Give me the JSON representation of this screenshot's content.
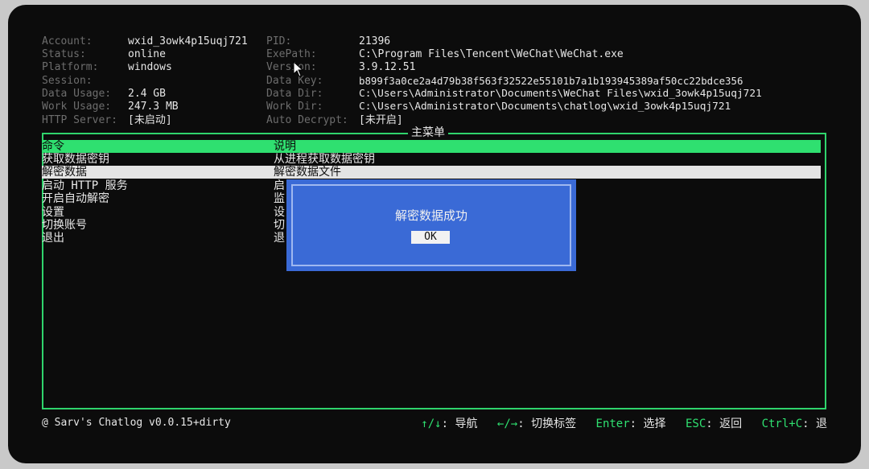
{
  "info_left": [
    {
      "label": "Account:",
      "value": "wxid_3owk4p15uqj721"
    },
    {
      "label": "Status:",
      "value": "online"
    },
    {
      "label": "Platform:",
      "value": "windows"
    },
    {
      "label": "Session:",
      "value": ""
    },
    {
      "label": "Data Usage:",
      "value": "2.4 GB"
    },
    {
      "label": "Work Usage:",
      "value": "247.3 MB"
    },
    {
      "label": "HTTP Server:",
      "value": "[未启动]"
    }
  ],
  "info_right": [
    {
      "label": "PID:",
      "value": "21396"
    },
    {
      "label": "ExePath:",
      "value": "C:\\Program Files\\Tencent\\WeChat\\WeChat.exe"
    },
    {
      "label": "Version:",
      "value": "3.9.12.51"
    },
    {
      "label": "Data Key:",
      "value": "b899f3a0ce2a4d79b38f563f32522e55101b7a1b193945389af50cc22bdce356"
    },
    {
      "label": "Data Dir:",
      "value": "C:\\Users\\Administrator\\Documents\\WeChat Files\\wxid_3owk4p15uqj721"
    },
    {
      "label": "Work Dir:",
      "value": "C:\\Users\\Administrator\\Documents\\chatlog\\wxid_3owk4p15uqj721"
    },
    {
      "label": "Auto Decrypt:",
      "value": "[未开启]"
    }
  ],
  "menu": {
    "title": "主菜单",
    "header": {
      "command": "命令",
      "description": "说明"
    },
    "items": [
      {
        "command": "获取数据密钥",
        "description": "从进程获取数据密钥"
      },
      {
        "command": "解密数据",
        "description": "解密数据文件"
      },
      {
        "command": "启动 HTTP 服务",
        "description": "启"
      },
      {
        "command": "开启自动解密",
        "description": "监"
      },
      {
        "command": "设置",
        "description": "设"
      },
      {
        "command": "切换账号",
        "description": "切"
      },
      {
        "command": "退出",
        "description": "退"
      }
    ]
  },
  "dialog": {
    "message": "解密数据成功",
    "ok_label": "OK"
  },
  "footer": {
    "app_name": "@ Sarv's Chatlog v0.0.15+dirty",
    "hints": [
      {
        "key": "↑/↓",
        "desc": ": 导航"
      },
      {
        "key": "←/→",
        "desc": ": 切换标签"
      },
      {
        "key": "Enter",
        "desc": ": 选择"
      },
      {
        "key": "ESC",
        "desc": ": 返回"
      },
      {
        "key": "Ctrl+C",
        "desc": ": 退"
      }
    ]
  },
  "colors": {
    "accent": "#2fe070",
    "dialog_bg": "#3a6ad6",
    "label": "#6d6d6d",
    "background": "#0c0c0c"
  }
}
